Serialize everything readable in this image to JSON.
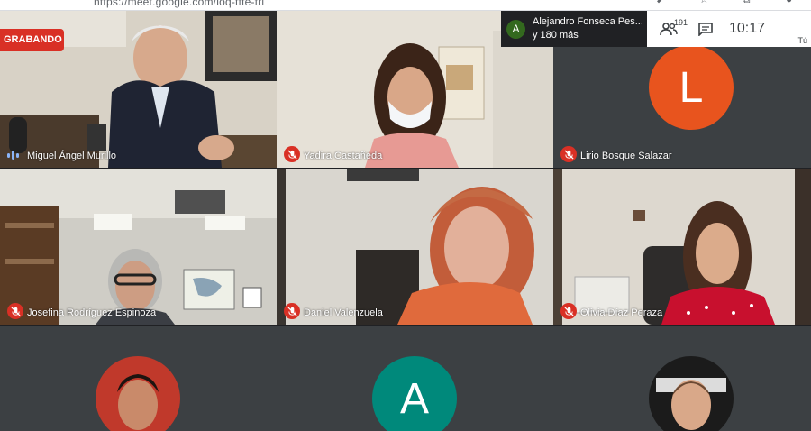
{
  "browser": {
    "url": "https://meet.google.com/ioq-tfte-fri"
  },
  "recording": {
    "label": "GRABANDO"
  },
  "presenter": {
    "avatar_letter": "A",
    "name": "Alejandro Fonseca Pes...",
    "more": "y 180 más"
  },
  "toolbar": {
    "participants_count": "191",
    "time": "10:17",
    "you_label": "Tú"
  },
  "tiles": [
    {
      "name": "Miguel Ángel Murillo",
      "muted": false
    },
    {
      "name": "Yadira Castañeda",
      "muted": true
    },
    {
      "name": "Lirio Bosque Salazar",
      "muted": true,
      "avatar_letter": "L",
      "avatar_color": "#e8541e"
    },
    {
      "name": "Josefina Rodríguez Espinoza",
      "muted": true
    },
    {
      "name": "Daniel Valenzuela",
      "muted": true
    },
    {
      "name": "Olivia Díaz Peraza",
      "muted": true
    }
  ],
  "bottom_row": [
    {
      "kind": "photo"
    },
    {
      "kind": "letter",
      "avatar_letter": "A",
      "avatar_color": "#00897b"
    },
    {
      "kind": "photo"
    }
  ],
  "colors": {
    "grid_bg": "#202124",
    "mute_red": "#d93025",
    "speaking_blue": "#8ab4f8"
  }
}
